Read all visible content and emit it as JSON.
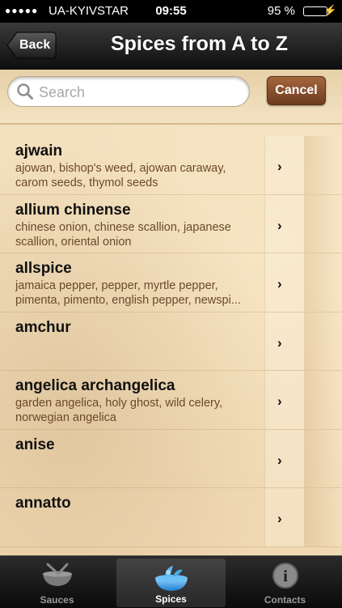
{
  "status_bar": {
    "signal": "●●●●●",
    "carrier": "UA-KYIVSTAR",
    "time": "09:55",
    "battery_percent": "95 %",
    "battery_level": 0.95
  },
  "navbar": {
    "back_label": "Back",
    "title": "Spices from A to Z"
  },
  "search": {
    "placeholder": "Search",
    "cancel_label": "Cancel"
  },
  "spices": [
    {
      "name": "ajwain",
      "synonyms": "ajowan, bishop's weed, ajowan caraway, carom seeds, thymol seeds"
    },
    {
      "name": "allium chinense",
      "synonyms": "chinese onion, chinese scallion, japanese scallion, oriental onion"
    },
    {
      "name": "allspice",
      "synonyms": "jamaica pepper, pepper, myrtle pepper, pimenta, pimento, english pepper, newspi..."
    },
    {
      "name": "amchur",
      "synonyms": ""
    },
    {
      "name": "angelica archangelica",
      "synonyms": "garden angelica, holy ghost, wild celery, norwegian angelica"
    },
    {
      "name": "anise",
      "synonyms": ""
    },
    {
      "name": "annatto",
      "synonyms": ""
    }
  ],
  "chevron": "›",
  "tabs": [
    {
      "label": "Sauces",
      "icon": "sauces-bowl-icon"
    },
    {
      "label": "Spices",
      "icon": "spices-bowl-icon",
      "active": true
    },
    {
      "label": "Contacts",
      "icon": "contacts-info-icon"
    }
  ],
  "colors": {
    "accent_cancel": "#8a4e2c",
    "paper": "#f2dcb8",
    "synonym_text": "#6b4a2a"
  }
}
